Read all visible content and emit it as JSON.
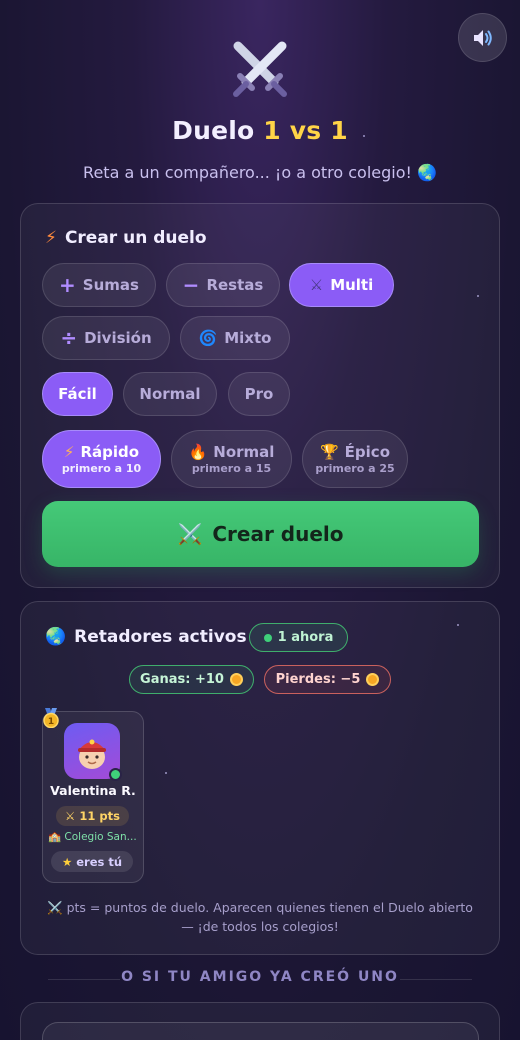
{
  "header": {
    "title_prefix": "Duelo ",
    "title_highlight": "1 vs 1",
    "subtitle": "Reta a un compañero... ¡o a otro colegio! 🌏",
    "sound_icon": "speaker-icon"
  },
  "create": {
    "title": "Crear un duelo",
    "title_icon": "⚡",
    "operations": [
      {
        "icon": "+",
        "label": "Sumas"
      },
      {
        "icon": "−",
        "label": "Restas"
      },
      {
        "icon": "⚔",
        "label": "Multi"
      },
      {
        "icon": "÷",
        "label": "División"
      },
      {
        "icon": "🌀",
        "label": "Mixto"
      }
    ],
    "difficulties": [
      "Fácil",
      "Normal",
      "Pro"
    ],
    "modes": [
      {
        "icon": "⚡",
        "label": "Rápido",
        "sub": "primero a 10"
      },
      {
        "icon": "🔥",
        "label": "Normal",
        "sub": "primero a 15"
      },
      {
        "icon": "🏆",
        "label": "Épico",
        "sub": "primero a 25"
      }
    ],
    "button": "Crear duelo",
    "button_icon": "⚔️",
    "selected_operation": "Multi",
    "selected_difficulty": "Fácil",
    "selected_mode": "Rápido"
  },
  "challengers": {
    "title": "Retadores activos",
    "title_icon": "🌏",
    "online_badge": "1 ahora",
    "win_label": "Ganas: +10",
    "lose_label": "Pierdes: −5",
    "players": [
      {
        "rank": "1",
        "name": "Valentina R.",
        "points": "11 pts",
        "school": "🏫 Colegio San...",
        "you": "eres tú"
      }
    ],
    "note": "⚔️ pts = puntos de duelo. Aparecen quienes tienen el Duelo abierto — ¡de todos los colegios!"
  },
  "divider": "O SI TU AMIGO YA CREÓ UNO",
  "colors": {
    "accent": "#8b5cf6",
    "create_button": "#3fbf6f",
    "title_highlight": "#ffd447"
  }
}
